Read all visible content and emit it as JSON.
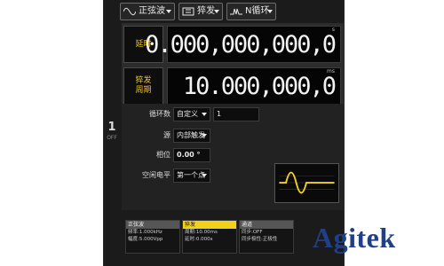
{
  "header": {
    "modes": [
      {
        "label": "正弦波",
        "icon": "sine-wave-icon"
      },
      {
        "label": "猝发",
        "icon": "burst-icon"
      },
      {
        "label": "N循环",
        "icon": "n-cycle-icon"
      }
    ]
  },
  "delay": {
    "label_line1": "延时",
    "value": "0.000,000,000,0",
    "unit": "s"
  },
  "period": {
    "label_line1": "猝发",
    "label_line2": "周期",
    "value": "10.000,000,0",
    "unit": "ms"
  },
  "channel": {
    "number": "1",
    "state": "OFF"
  },
  "params": {
    "cycles_label": "循环数",
    "cycles_mode": "自定义",
    "cycles_value": "1",
    "source_label": "源",
    "source_value": "内部触发",
    "phase_label": "相位",
    "phase_value": "0.00 °",
    "idle_label": "空闲电平",
    "idle_value": "第一个点"
  },
  "summary": {
    "sine": {
      "title": "正弦波",
      "line1": "频率:1.000kHz",
      "line2": "幅度:5.000Vpp"
    },
    "burst": {
      "title": "猝发",
      "line1": "周期:10.00ms",
      "line2": "延时:0.000s"
    },
    "channel": {
      "title": "通道",
      "line1": "同步:OFF",
      "line2": "同步极性:正极性"
    }
  },
  "colors": {
    "accent": "#f1c21b",
    "preview_wave": "#f1d21b",
    "logo": "#1f3f8a"
  },
  "logo": {
    "text": "Agitek"
  }
}
